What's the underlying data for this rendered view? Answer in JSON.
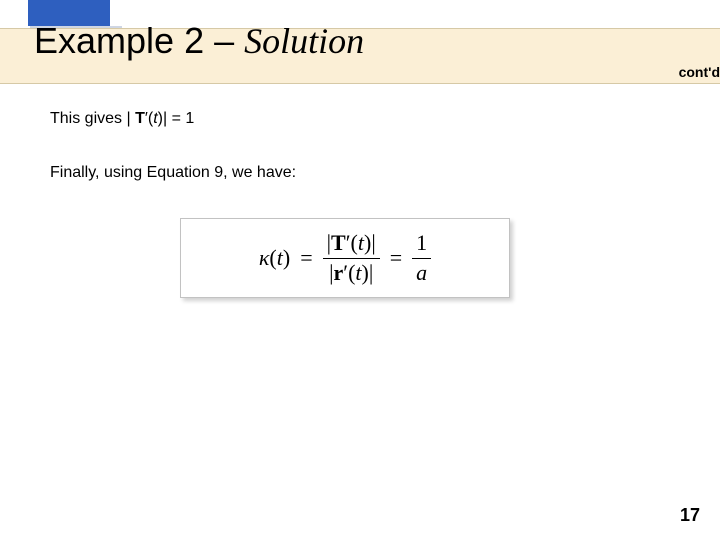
{
  "header": {
    "title_pre": "Example 2",
    "title_sep": " – ",
    "title_post": "Solution",
    "contd": "cont'd"
  },
  "body": {
    "line1_pre": "This gives | ",
    "line1_T": "T",
    "line1_prime": "′(",
    "line1_t": "t",
    "line1_post": ")| = 1",
    "line2": "Finally, using Equation 9, we have:"
  },
  "equation": {
    "kappa": "κ",
    "lparen": "(",
    "t": "t",
    "rparen": ")",
    "eq": "=",
    "bar_l": "|",
    "bar_r": "|",
    "T": "T",
    "r": "r",
    "prime": "′",
    "one": "1",
    "a": "a"
  },
  "footer": {
    "page": "17"
  }
}
